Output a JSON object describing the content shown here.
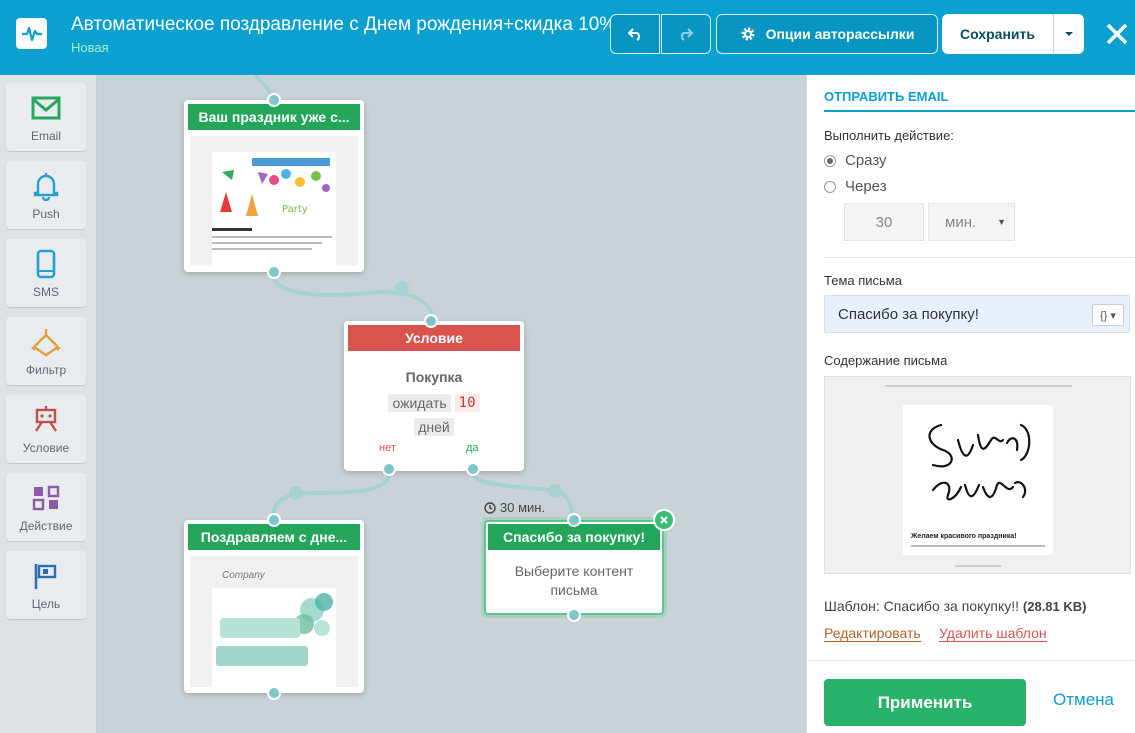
{
  "header": {
    "title": "Автоматическое поздравление с Днем рождения+скидка 10%",
    "status": "Новая",
    "options_label": "Опции авторассылки",
    "save_label": "Сохранить"
  },
  "tools": [
    {
      "label": "Email",
      "icon": "envelope-icon"
    },
    {
      "label": "Push",
      "icon": "bell-icon"
    },
    {
      "label": "SMS",
      "icon": "phone-icon"
    },
    {
      "label": "Фильтр",
      "icon": "filter-icon"
    },
    {
      "label": "Условие",
      "icon": "condition-icon"
    },
    {
      "label": "Действие",
      "icon": "action-icon"
    },
    {
      "label": "Цель",
      "icon": "flag-icon"
    }
  ],
  "flow": {
    "node1": {
      "title": "Ваш праздник уже с..."
    },
    "condition": {
      "title": "Условие",
      "event": "Покупка",
      "wait_label": "ожидать",
      "wait_value": "10",
      "unit": "дней",
      "no_label": "нет",
      "yes_label": "да"
    },
    "node2": {
      "title": "Поздравляем с дне...",
      "thumb_text": "Company"
    },
    "node3": {
      "title": "Спасибо за покупку!",
      "delay": "30 мин.",
      "placeholder": "Выберите контент письма"
    }
  },
  "panel": {
    "section_title": "ОТПРАВИТЬ EMAIL",
    "action_label": "Выполнить действие:",
    "option_now": "Сразу",
    "option_after": "Через",
    "delay_value": "30",
    "delay_unit": "мин.",
    "subject_label": "Тема письма",
    "subject_value": "Спасибо за покупку!",
    "content_label": "Содержание письма",
    "preview_greeting": "Желаем красивого праздника!",
    "template_prefix": "Шаблон: Спасибо за покупку!!",
    "template_size": "(28.81 KB)",
    "edit_label": "Редактировать",
    "delete_label": "Удалить шаблон",
    "apply_label": "Применить",
    "cancel_label": "Отмена"
  },
  "colors": {
    "header": "#0aa0cf",
    "green": "#23a55a",
    "red": "#d9534f",
    "connector": "#7fc6c6"
  }
}
